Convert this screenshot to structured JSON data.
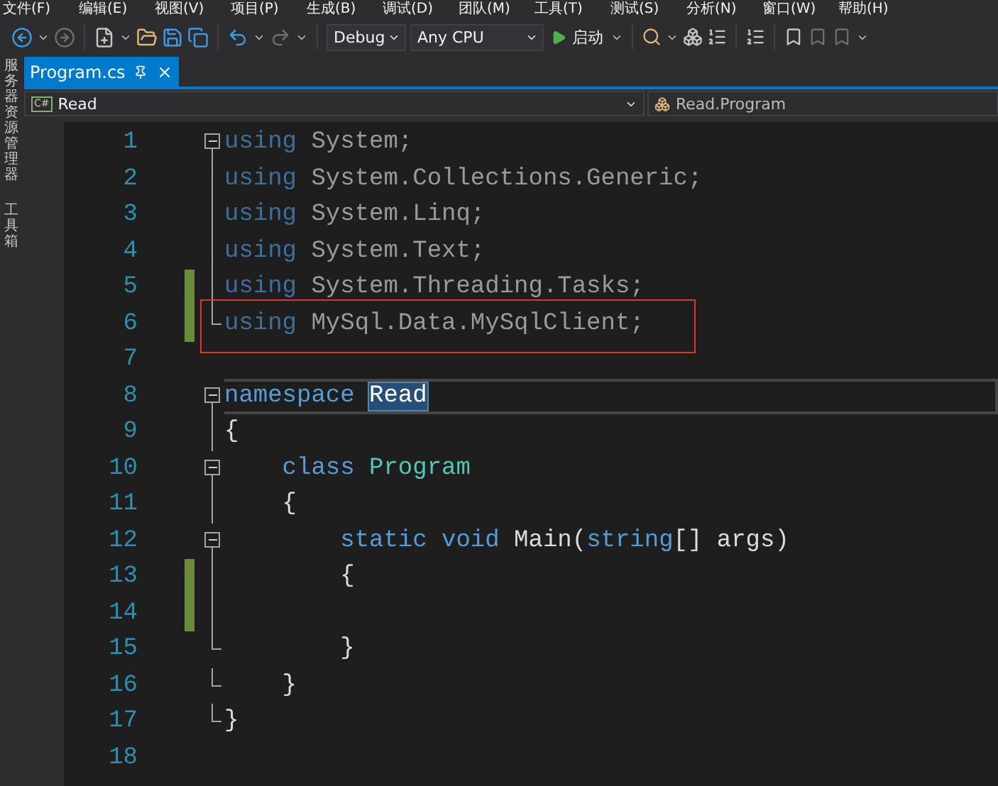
{
  "menu": [
    "文件(F)",
    "编辑(E)",
    "视图(V)",
    "项目(P)",
    "生成(B)",
    "调试(D)",
    "团队(M)",
    "工具(T)",
    "测试(S)",
    "分析(N)",
    "窗口(W)",
    "帮助(H)"
  ],
  "toolbar": {
    "configuration": "Debug",
    "platform": "Any CPU",
    "start": "启动"
  },
  "side_tabs": [
    "服务器资源管理器",
    "工具箱"
  ],
  "tabs": [
    {
      "label": "Program.cs",
      "selected": true
    }
  ],
  "nav": {
    "scope_icon": "C#",
    "scope": "Read",
    "member": "Read.Program"
  },
  "lines": [
    {
      "number": "1",
      "kind": "fold_start",
      "changed": false,
      "boxed": false,
      "current": false,
      "tokens": [
        {
          "kind": "faded_keyword",
          "text": "using "
        },
        {
          "kind": "faded",
          "text": "System;"
        }
      ]
    },
    {
      "number": "2",
      "kind": "fold_line",
      "changed": false,
      "boxed": false,
      "current": false,
      "tokens": [
        {
          "kind": "faded_keyword",
          "text": "using "
        },
        {
          "kind": "faded",
          "text": "System.Collections.Generic;"
        }
      ]
    },
    {
      "number": "3",
      "kind": "fold_line",
      "changed": false,
      "boxed": false,
      "current": false,
      "tokens": [
        {
          "kind": "faded_keyword",
          "text": "using "
        },
        {
          "kind": "faded",
          "text": "System.Linq;"
        }
      ]
    },
    {
      "number": "4",
      "kind": "fold_line",
      "changed": false,
      "boxed": false,
      "current": false,
      "tokens": [
        {
          "kind": "faded_keyword",
          "text": "using "
        },
        {
          "kind": "faded",
          "text": "System.Text;"
        }
      ]
    },
    {
      "number": "5",
      "kind": "fold_line",
      "changed": true,
      "boxed": false,
      "current": false,
      "tokens": [
        {
          "kind": "faded_keyword",
          "text": "using "
        },
        {
          "kind": "faded",
          "text": "System.Threading.Tasks;"
        }
      ]
    },
    {
      "number": "6",
      "kind": "fold_end",
      "changed": true,
      "boxed": true,
      "current": false,
      "tokens": [
        {
          "kind": "faded_keyword",
          "text": "using "
        },
        {
          "kind": "faded",
          "text": "MySql.Data.MySqlClient;"
        }
      ]
    },
    {
      "number": "7",
      "kind": "plain",
      "changed": false,
      "boxed": false,
      "current": false
    },
    {
      "number": "8",
      "kind": "fold_start",
      "changed": false,
      "boxed": false,
      "current": true,
      "tokens": [
        {
          "kind": "keyword",
          "text": "namespace "
        },
        {
          "kind": "selected",
          "text": "Read"
        }
      ]
    },
    {
      "number": "9",
      "kind": "fold_line",
      "changed": false,
      "boxed": false,
      "current": false,
      "tokens": [
        {
          "kind": "plain",
          "text": "{"
        }
      ]
    },
    {
      "number": "10",
      "kind": "fold_start",
      "changed": false,
      "boxed": false,
      "current": false,
      "tokens": [
        {
          "kind": "keyword",
          "text": "    class "
        },
        {
          "kind": "type",
          "text": "Program"
        }
      ]
    },
    {
      "number": "11",
      "kind": "fold_line",
      "changed": false,
      "boxed": false,
      "current": false,
      "tokens": [
        {
          "kind": "plain",
          "text": "    {"
        }
      ]
    },
    {
      "number": "12",
      "kind": "fold_start",
      "changed": false,
      "boxed": false,
      "current": false,
      "tokens": [
        {
          "kind": "keyword",
          "text": "        static void "
        },
        {
          "kind": "plain",
          "text": "Main("
        },
        {
          "kind": "keyword",
          "text": "string"
        },
        {
          "kind": "plain",
          "text": "[] args)"
        }
      ]
    },
    {
      "number": "13",
      "kind": "fold_line",
      "changed": true,
      "boxed": false,
      "current": false,
      "tokens": [
        {
          "kind": "plain",
          "text": "        {"
        }
      ]
    },
    {
      "number": "14",
      "kind": "fold_line",
      "changed": true,
      "boxed": false,
      "current": false
    },
    {
      "number": "15",
      "kind": "fold_end",
      "changed": false,
      "boxed": false,
      "current": false,
      "tokens": [
        {
          "kind": "plain",
          "text": "        }"
        }
      ]
    },
    {
      "number": "16",
      "kind": "fold_end",
      "changed": false,
      "boxed": false,
      "current": false,
      "tokens": [
        {
          "kind": "plain",
          "text": "    }"
        }
      ]
    },
    {
      "number": "17",
      "kind": "fold_end",
      "changed": false,
      "boxed": false,
      "current": false,
      "tokens": [
        {
          "kind": "plain",
          "text": "}"
        }
      ]
    },
    {
      "number": "18",
      "kind": "plain",
      "changed": false,
      "boxed": false,
      "current": false
    }
  ]
}
